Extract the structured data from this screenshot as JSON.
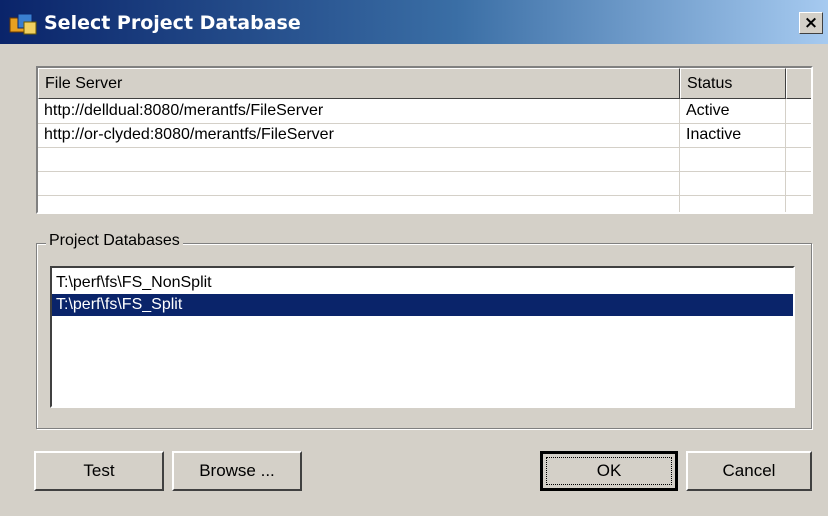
{
  "window": {
    "title": "Select Project Database",
    "close_glyph": "×",
    "icon": "app-icon"
  },
  "file_servers": {
    "columns": [
      "File Server",
      "Status"
    ],
    "rows": [
      {
        "server": "http://delldual:8080/merantfs/FileServer",
        "status": "Active"
      },
      {
        "server": "http://or-clyded:8080/merantfs/FileServer",
        "status": "Inactive"
      }
    ]
  },
  "project_databases": {
    "label": "Project Databases",
    "items": [
      "T:\\perf\\fs\\FS_NonSplit",
      "T:\\perf\\fs\\FS_Split"
    ],
    "selected_index": 1
  },
  "buttons": {
    "test": "Test",
    "browse": "Browse ...",
    "ok": "OK",
    "cancel": "Cancel"
  },
  "colors": {
    "selection": "#0a246a",
    "face": "#d4d0c8"
  }
}
